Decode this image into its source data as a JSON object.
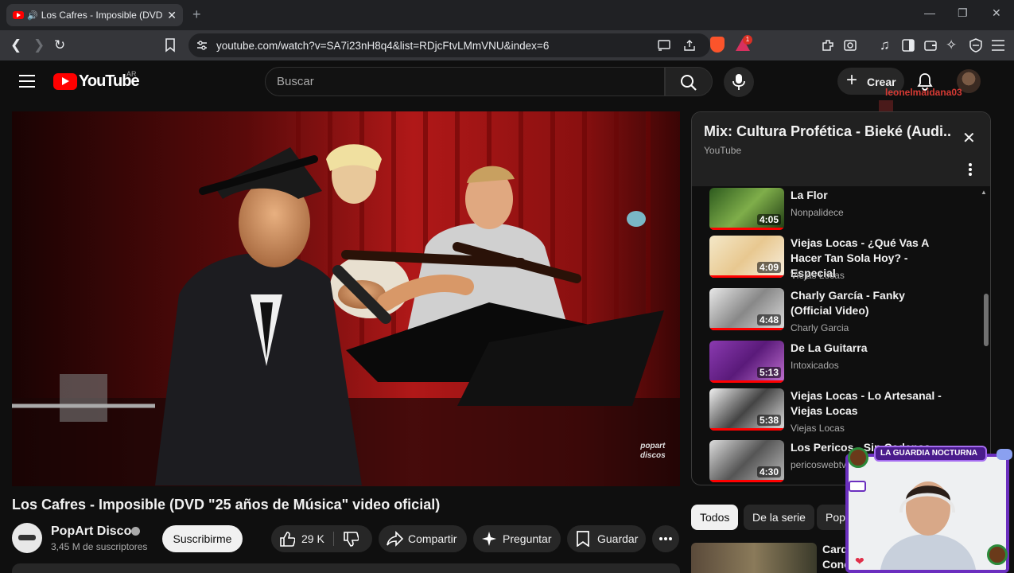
{
  "browser": {
    "tab_title": "Los Cafres - Imposible (DVD",
    "new_tab": "+",
    "url": "youtube.com/watch?v=SA7i23nH8q4&list=RDjcFtvLMmVNU&index=6",
    "brave_badge": "1",
    "window_minimize": "—",
    "window_maximize": "❐",
    "window_close": "✕"
  },
  "header": {
    "logo_text": "YouTube",
    "country_code": "AR",
    "search_placeholder": "Buscar",
    "create_label": "Crear",
    "username": "leonelmaidana03"
  },
  "video": {
    "title": "Los Cafres - Imposible (DVD \"25 años de Música\" video oficial)",
    "watermark_line1": "popart",
    "watermark_line2": "discos",
    "channel_name": "PopArt Discos",
    "subscribers": "3,45 M de suscriptores",
    "subscribe_label": "Suscribirme",
    "likes": "29 K",
    "share_label": "Compartir",
    "ask_label": "Preguntar",
    "save_label": "Guardar"
  },
  "playlist": {
    "title": "Mix: Cultura Profética - Bieké (Audi...",
    "subtitle": "YouTube",
    "items": [
      {
        "title": "La Flor",
        "channel": "Nonpalidece",
        "duration": "4:05"
      },
      {
        "title": "Viejas Locas - ¿Qué Vas A Hacer Tan Sola Hoy? - Especial",
        "channel": "Viejas Locas",
        "duration": "4:09"
      },
      {
        "title": "Charly García - Fanky (Official Video)",
        "channel": "Charly Garcia",
        "duration": "4:48"
      },
      {
        "title": "De La Guitarra",
        "channel": "Intoxicados",
        "duration": "5:13"
      },
      {
        "title": "Viejas Locas - Lo Artesanal - Viejas Locas",
        "channel": "Viejas Locas",
        "duration": "5:38"
      },
      {
        "title": "Los Pericos - Sin Cadenas",
        "channel": "pericoswebtv",
        "duration": "4:30"
      }
    ]
  },
  "chips": [
    "Todos",
    "De la serie",
    "Pop"
  ],
  "recommendation": {
    "title_line1": "Card",
    "title_line2": "Conc"
  },
  "overlay": {
    "badge_text": "LA GUARDIA NOCTURNA"
  },
  "colors": {
    "brand_red": "#ff0000",
    "accent_purple": "#6b2fbf"
  }
}
